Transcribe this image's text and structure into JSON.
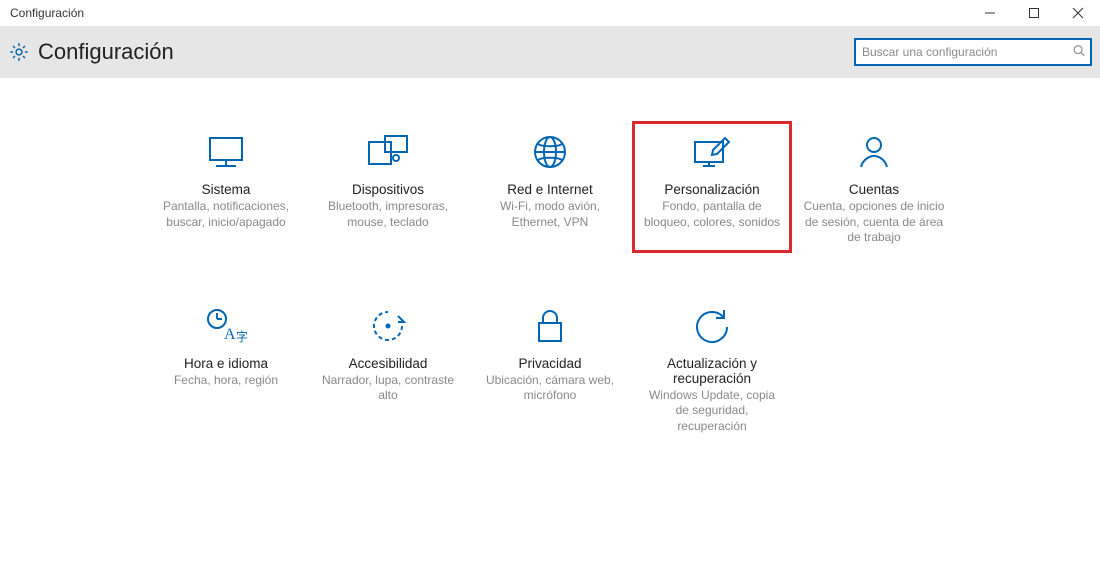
{
  "window": {
    "title": "Configuración"
  },
  "header": {
    "title": "Configuración"
  },
  "search": {
    "placeholder": "Buscar una configuración"
  },
  "tiles": {
    "sistema": {
      "title": "Sistema",
      "desc": "Pantalla, notificaciones, buscar, inicio/apagado"
    },
    "dispositivos": {
      "title": "Dispositivos",
      "desc": "Bluetooth, impresoras, mouse, teclado"
    },
    "red": {
      "title": "Red e Internet",
      "desc": "Wi-Fi, modo avión, Ethernet, VPN"
    },
    "personalizacion": {
      "title": "Personalización",
      "desc": "Fondo, pantalla de bloqueo, colores, sonidos"
    },
    "cuentas": {
      "title": "Cuentas",
      "desc": "Cuenta, opciones de inicio de sesión, cuenta de área de trabajo"
    },
    "hora": {
      "title": "Hora e idioma",
      "desc": "Fecha, hora, región"
    },
    "accesibilidad": {
      "title": "Accesibilidad",
      "desc": "Narrador, lupa, contraste alto"
    },
    "privacidad": {
      "title": "Privacidad",
      "desc": "Ubicación, cámara web, micrófono"
    },
    "actualizacion": {
      "title": "Actualización y recuperación",
      "desc": "Windows Update, copia de seguridad, recuperación"
    }
  },
  "colors": {
    "accent": "#0066b3",
    "highlight": "#d9282f",
    "muted": "#888888"
  }
}
